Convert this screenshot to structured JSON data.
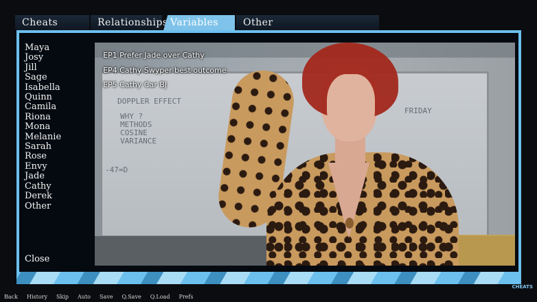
{
  "tabs": [
    {
      "label": "Cheats",
      "active": false
    },
    {
      "label": "Relationships",
      "active": false
    },
    {
      "label": "Variables",
      "active": true
    },
    {
      "label": "Other",
      "active": false
    }
  ],
  "sidebar": {
    "items": [
      "Maya",
      "Josy",
      "Jill",
      "Sage",
      "Isabella",
      "Quinn",
      "Camila",
      "Riona",
      "Mona",
      "Melanie",
      "Sarah",
      "Rose",
      "Envy",
      "Jade",
      "Cathy",
      "Derek",
      "Other"
    ],
    "close_label": "Close"
  },
  "variables": [
    "EP1 Prefer Jade over Cathy",
    "EP4 Cathy Swyper best outcome",
    "EP5 Cathy Car BJ"
  ],
  "board_text": {
    "line1": "DOPPLER EFFECT",
    "line2": "WHY ?",
    "line3": "METHODS",
    "line4": "COSINE",
    "line5": "VARIANCE",
    "line6": "FRIDAY",
    "line7": "-47=D"
  },
  "quick_menu": [
    "Back",
    "History",
    "Skip",
    "Auto",
    "Save",
    "Q.Save",
    "Q.Load",
    "Prefs"
  ],
  "logo_text": "CHEATS",
  "colors": {
    "accent": "#6cc0ee",
    "active_tab": "#7fc3ea",
    "background": "#050a10"
  }
}
